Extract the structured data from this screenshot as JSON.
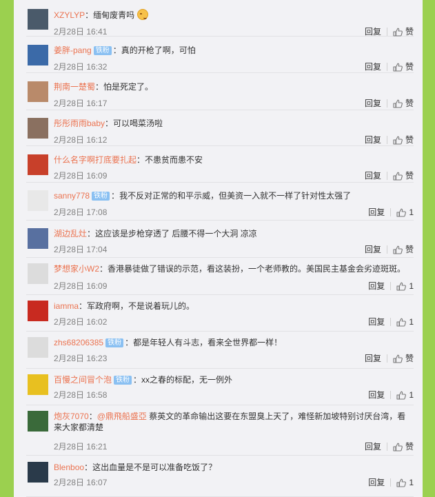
{
  "labels": {
    "reply": "回复",
    "like": "赞"
  },
  "comments": [
    {
      "user": "XZYLYP",
      "sep": "：",
      "text": "缅甸废青吗",
      "emoji": true,
      "time": "2月28日 16:41",
      "likes": "赞",
      "avatar": "#4a5a6a"
    },
    {
      "user": "姜胖-pang",
      "badge": "铁粉",
      "sep": "：",
      "text": "真的开枪了啊，可怕",
      "time": "2月28日 16:32",
      "likes": "赞",
      "avatar": "#3b6aa8"
    },
    {
      "user": "荆南一楚蜀",
      "sep": "：",
      "text": "怕是死定了。",
      "time": "2月28日 16:17",
      "likes": "赞",
      "avatar": "#b98a6a"
    },
    {
      "user": "彤彤雨雨baby",
      "sep": "：",
      "text": "可以喝菜汤啦",
      "time": "2月28日 16:12",
      "likes": "赞",
      "avatar": "#8a7060"
    },
    {
      "user": "什么名字啊打底要扎起",
      "sep": "：",
      "text": "不患贫而患不安",
      "time": "2月28日 16:09",
      "likes": "赞",
      "avatar": "#c8402a"
    },
    {
      "user": "sanny778",
      "badge": "铁粉",
      "sep": "：",
      "text": "我不反对正常的和平示威，但美资一入就不一样了针对性太强了",
      "time": "2月28日 17:08",
      "likes": "1",
      "avatar": "#e8e8e8"
    },
    {
      "user": "湖边乱灶",
      "sep": "：",
      "text": "这应该是步枪穿透了  后腰不得一个大洞  凉凉",
      "time": "2月28日 17:04",
      "likes": "赞",
      "avatar": "#5870a0"
    },
    {
      "user": "梦想家小W2",
      "sep": "：",
      "text": "香港暴徒做了错误的示范，看这装扮，一个老师教的。美国民主基金会劣迹斑斑。",
      "time": "2月28日 16:09",
      "likes": "1",
      "avatar": "#dcdcdc"
    },
    {
      "user": "iamma",
      "sep": "：",
      "text": "军政府啊，不是说着玩儿的。",
      "time": "2月28日 16:02",
      "likes": "1",
      "avatar": "#c82a20"
    },
    {
      "user": "zhs68206385",
      "badge": "铁粉",
      "sep": "：",
      "text": "都是年轻人有斗志，看来全世界都一样！",
      "time": "2月28日 16:23",
      "likes": "赞",
      "avatar": "#dcdcdc"
    },
    {
      "user": "百慢之间冒个泡",
      "badge": "铁粉",
      "sep": "：",
      "text": "xx之春的标配，无一例外",
      "time": "2月28日 16:58",
      "likes": "1",
      "avatar": "#e8c020"
    },
    {
      "user": "炮灰7070",
      "sep": "：",
      "mention": "@鼎飛船盛亞",
      "text": " 蔡英文的革命输出这要在东盟臭上天了，难怪新加坡特别讨厌台湾，看来大家都清楚",
      "time": "2月28日 16:21",
      "likes": "赞",
      "avatar": "#3a6a3a"
    },
    {
      "user": "Blenboo",
      "sep": "：",
      "text": "这出血量是不是可以准备吃饭了？",
      "time": "2月28日 16:07",
      "likes": "1",
      "avatar": "#2a3a4a"
    }
  ]
}
